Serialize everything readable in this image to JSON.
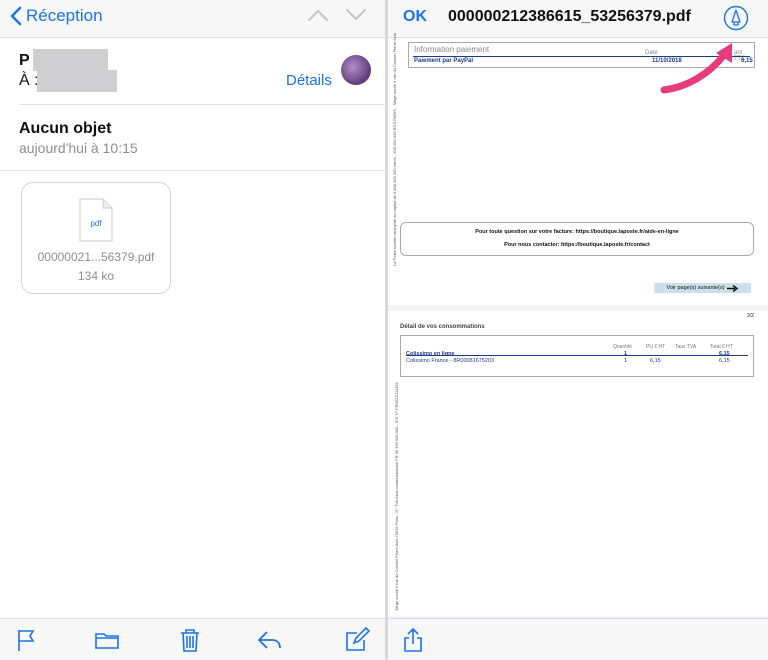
{
  "mail": {
    "back_label": "Réception",
    "from_initial": "P",
    "to_label": "À :",
    "details_label": "Détails",
    "subject": "Aucun objet",
    "date": "aujourd'hui à 10:15",
    "attachment": {
      "type_label": "pdf",
      "name": "00000021...56379.pdf",
      "size": "134 ko"
    }
  },
  "viewer": {
    "ok_label": "OK",
    "title": "000000212386615_53256379.pdf",
    "accent": "#1a73e8",
    "arrow_color": "#e73b7b",
    "page1": {
      "side_text": "La Poste société anonyme au capital de 3 800 000 000 euros - 356 000 000 RCS PARIS - Siège social 9 rue du Colonel Pierre Avia",
      "payment_header": "Information paiement",
      "date_header": "Date",
      "amount_header": "ant TTC",
      "payment_label": "Paiement par PayPal",
      "payment_date": "11/10/2018",
      "payment_amount": "6,15",
      "contact_line1": "Pour toute question sur votre facture: https://boutique.laposte.fr/aide-en-ligne",
      "contact_line2": "Pour nous contacter: https://boutique.laposte.fr/contact",
      "next_page_label": "Voir page(s) suivante(s)"
    },
    "page2": {
      "page_number": "2/2",
      "side_text": "Siège social 9 rue du Colonel Pierre Avia 75015 Paris - N° TVA intra-communautaire FR 39 356 000 000 - ICS N° FR0ZZZ111361",
      "section_title": "Détail de vos consommations",
      "headers": [
        "Quantité",
        "PU € HT",
        "Taux TVA",
        "Total € HT"
      ],
      "row1": {
        "label": "Colissimo en ligne",
        "qty": "1",
        "total": "6,15"
      },
      "row2": {
        "label": "Colissimo France - 8R00081675203",
        "qty": "1",
        "unit": "6,15",
        "total": "6,15"
      }
    }
  }
}
